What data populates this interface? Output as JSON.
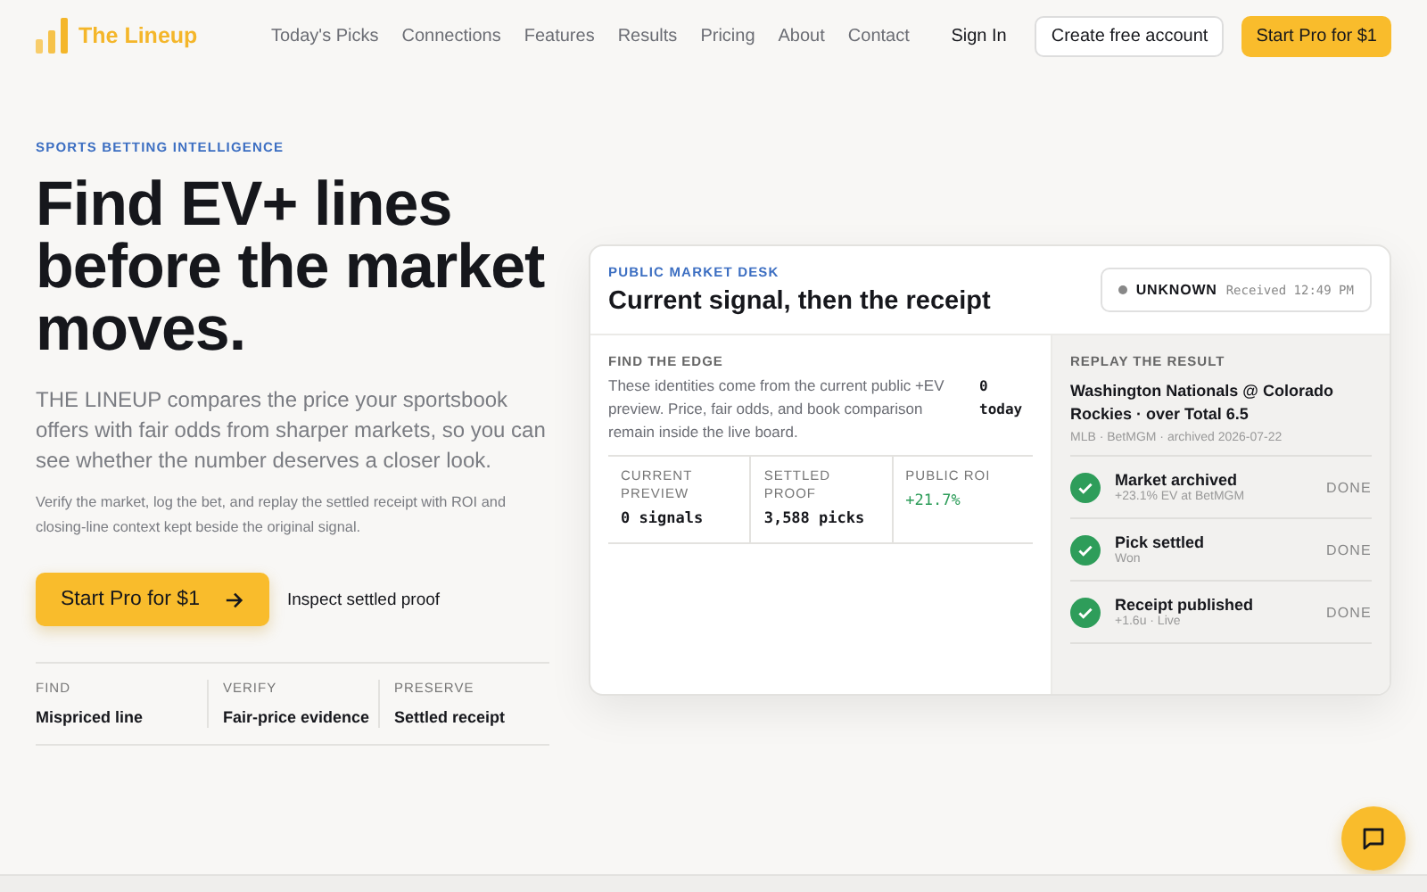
{
  "brand": {
    "name": "The Lineup"
  },
  "nav": {
    "links": [
      "Today's Picks",
      "Connections",
      "Features",
      "Results",
      "Pricing",
      "About",
      "Contact"
    ],
    "sign_in": "Sign In",
    "create_account": "Create free account",
    "cta": "Start Pro for $1"
  },
  "hero": {
    "eyebrow": "SPORTS BETTING INTELLIGENCE",
    "title": "Find EV+ lines before the market moves.",
    "lead": "THE LINEUP compares the price your sportsbook offers with fair odds from sharper markets, so you can see whether the number deserves a closer look.",
    "sub": "Verify the market, log the bet, and replay the settled receipt with ROI and closing-line context kept beside the original signal.",
    "primary_button": "Start Pro for $1",
    "secondary_link": "Inspect settled proof",
    "pillars": [
      {
        "label": "FIND",
        "value": "Mispriced line"
      },
      {
        "label": "VERIFY",
        "value": "Fair-price evidence"
      },
      {
        "label": "PRESERVE",
        "value": "Settled receipt"
      }
    ]
  },
  "desk": {
    "eyebrow": "PUBLIC MARKET DESK",
    "title": "Current signal, then the receipt",
    "status": {
      "label": "UNKNOWN",
      "received": "Received 12:49 PM"
    },
    "edge": {
      "heading": "FIND THE EDGE",
      "text": "These identities come from the current public +EV preview. Price, fair odds, and book comparison remain inside the live board.",
      "count": "0 today",
      "stats": [
        {
          "label": "CURRENT PREVIEW",
          "value": "0 signals",
          "positive": false
        },
        {
          "label": "SETTLED PROOF",
          "value": "3,588 picks",
          "positive": false
        },
        {
          "label": "PUBLIC ROI",
          "value": "+21.7%",
          "positive": true
        }
      ]
    },
    "replay": {
      "heading": "REPLAY THE RESULT",
      "game": "Washington Nationals @ Colorado Rockies · over Total 6.5",
      "meta": "MLB · BetMGM · archived 2026-07-22",
      "steps": [
        {
          "title": "Market archived",
          "detail": "+23.1% EV at BetMGM",
          "status": "DONE",
          "done": true
        },
        {
          "title": "Pick settled",
          "detail": "Won",
          "status": "DONE",
          "done": true
        },
        {
          "title": "Receipt published",
          "detail": "+1.6u · Live",
          "status": "DONE",
          "done": true
        }
      ]
    }
  }
}
